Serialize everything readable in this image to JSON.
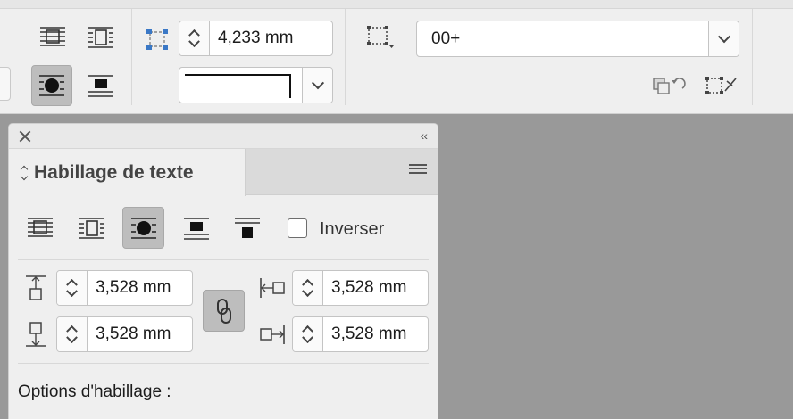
{
  "control_bar": {
    "offset_field": {
      "value": "4,233 mm"
    },
    "object_style_dropdown": {
      "value": "00+"
    },
    "icons": {
      "wrap_none": "text-wrap-none-icon",
      "wrap_bounding_box": "text-wrap-bounding-box-icon",
      "wrap_object_shape": "text-wrap-object-shape-icon",
      "wrap_jump_object": "text-wrap-jump-object-icon",
      "offset": "offset-corners-icon",
      "stroke_preview": "stroke-corner-preview",
      "frame_options": "frame-options-icon",
      "apply_style": "apply-object-style-icon",
      "clear_overrides": "clear-overrides-icon"
    },
    "selected_wrap": "object_shape"
  },
  "panel": {
    "title": "Habillage de texte",
    "wrap_buttons": [
      {
        "name": "text-wrap-none",
        "selected": false
      },
      {
        "name": "text-wrap-bounding-box",
        "selected": false
      },
      {
        "name": "text-wrap-object-shape",
        "selected": true
      },
      {
        "name": "text-wrap-jump-object",
        "selected": false
      },
      {
        "name": "text-wrap-next-column",
        "selected": false
      }
    ],
    "invert_label": "Inverser",
    "invert_checked": false,
    "offsets": {
      "top": "3,528 mm",
      "bottom": "3,528 mm",
      "left": "3,528 mm",
      "right": "3,528 mm"
    },
    "link_icon": "chain-link-icon",
    "options_label": "Options d'habillage :"
  },
  "colors": {
    "selected_button": "#bdbdbd",
    "offset_icon_accent": "#3a78c6",
    "workspace_bg": "#999999",
    "panel_bg": "#efefef"
  }
}
